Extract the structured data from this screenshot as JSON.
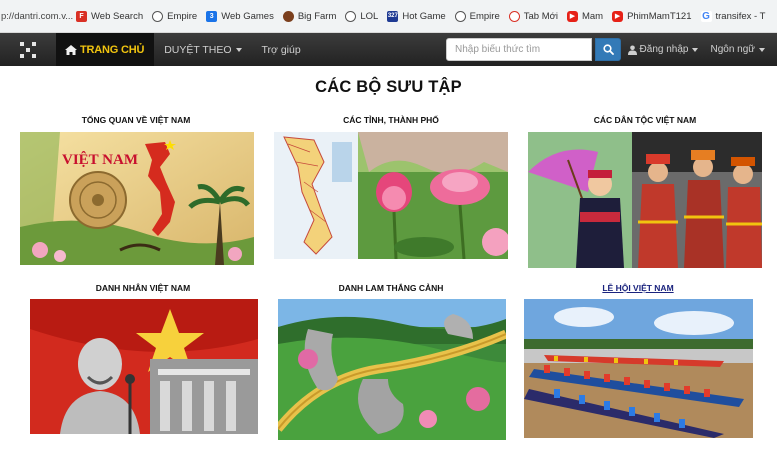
{
  "browser": {
    "url_fragment": "p://dantri.com.v...",
    "bookmarks": [
      {
        "label": "Web Search",
        "icon": "flipboard-icon"
      },
      {
        "label": "Empire",
        "icon": "globe-icon"
      },
      {
        "label": "Web Games",
        "icon": "web-games-icon"
      },
      {
        "label": "Big Farm",
        "icon": "big-farm-icon"
      },
      {
        "label": "LOL",
        "icon": "globe-icon"
      },
      {
        "label": "Hot Game",
        "icon": "hot-game-icon"
      },
      {
        "label": "Empire",
        "icon": "globe-icon"
      },
      {
        "label": "Tab Mới",
        "icon": "tab-icon"
      },
      {
        "label": "Mam",
        "icon": "youtube-icon"
      },
      {
        "label": "PhimMamT121",
        "icon": "youtube-icon"
      },
      {
        "label": "transifex - T",
        "icon": "google-icon"
      }
    ]
  },
  "navbar": {
    "home_label": "TRANG CHỦ",
    "browse_label": "DUYỆT THEO",
    "help_label": "Trợ giúp",
    "search_placeholder": "Nhập biểu thức tìm",
    "login_label": "Đăng nhập",
    "language_label": "Ngôn ngữ"
  },
  "main": {
    "title": "CÁC BỘ SƯU TẬP",
    "collections": [
      {
        "title": "TỔNG QUAN VỀ VIỆT NAM",
        "image_text": "VIỆT NAM"
      },
      {
        "title": "CÁC TỈNH, THÀNH PHỐ"
      },
      {
        "title": "CÁC DÂN TỘC VIỆT NAM"
      },
      {
        "title": "DANH NHÂN VIỆT NAM"
      },
      {
        "title": "DANH LAM THẮNG CẢNH"
      },
      {
        "title": "LỄ HỘI VIỆT NAM"
      }
    ]
  },
  "colors": {
    "navbar_bg": "#2b2b2b",
    "home_text": "#f1c40f",
    "search_button": "#337ab7",
    "link": "#1a237e"
  }
}
